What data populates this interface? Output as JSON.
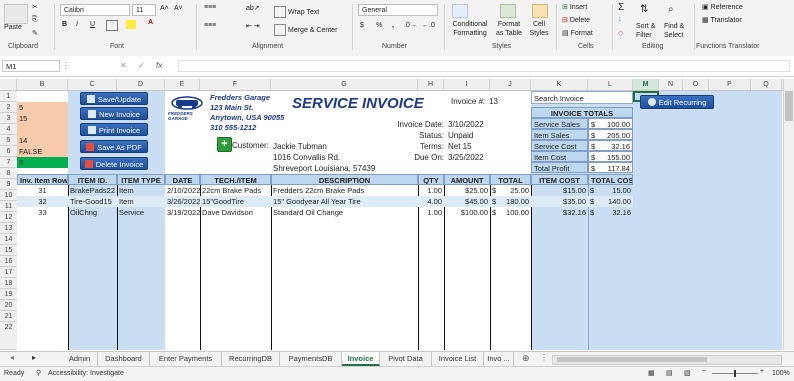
{
  "ribbon": {
    "clipboard": {
      "paste": "Paste",
      "label": "Clipboard"
    },
    "font": {
      "name": "Calibri",
      "size": "11",
      "label": "Font",
      "bold": "B",
      "italic": "I",
      "underline": "U"
    },
    "alignment": {
      "wrap": "Wrap Text",
      "merge": "Merge & Center",
      "label": "Alignment"
    },
    "number": {
      "format": "General",
      "label": "Number",
      "currency": "$",
      "percent": "%",
      "comma": ","
    },
    "styles": {
      "conditional": "Conditional Formatting",
      "table": "Format as Table",
      "cell": "Cell Styles",
      "label": "Styles"
    },
    "cells": {
      "insert": "Insert",
      "delete": "Delete",
      "format": "Format",
      "label": "Cells"
    },
    "editing": {
      "sum": "Σ",
      "sort": "Sort & Filter",
      "find": "Find & Select",
      "label": "Editing"
    },
    "translator": {
      "reference": "Reference",
      "translator": "Translator",
      "label": "Functions Translator"
    }
  },
  "formula_bar": {
    "name_box": "M1",
    "fx": "fx",
    "content": ""
  },
  "columns": [
    "A",
    "B",
    "C",
    "D",
    "E",
    "F",
    "G",
    "H",
    "I",
    "J",
    "K",
    "L",
    "M",
    "N",
    "O",
    "P",
    "Q"
  ],
  "rows": [
    "1",
    "2",
    "3",
    "4",
    "5",
    "6",
    "7",
    "8",
    "9",
    "10",
    "11",
    "12",
    "13",
    "14",
    "15",
    "16",
    "17",
    "18",
    "19",
    "20",
    "21",
    "22"
  ],
  "colB": {
    "r2": "5",
    "r3": "15",
    "r5": "14",
    "r6": "FALSE",
    "r7": "3",
    "r8": "Inv. Item Row"
  },
  "buttons": {
    "save_update": "Save/Update",
    "new_invoice": "New Invoice",
    "print_invoice": "Print Invoice",
    "save_pdf": "Save As PDF",
    "delete_invoice": "Delete Invoice",
    "edit_recurring": "Edit Recurring"
  },
  "company": {
    "name": "Fredders Garage",
    "address": "123 Main St.",
    "city": "Anytown, USA 90055",
    "phone": "310 555-1212",
    "logo_text": "FREDDERS GARAGE"
  },
  "invoice": {
    "title": "SERVICE INVOICE",
    "number_label": "Invoice #:",
    "number": "13",
    "date_label": "Invoice Date:",
    "date": "3/10/2022",
    "status_label": "Status:",
    "status": "Unpaid",
    "terms_label": "Terms:",
    "terms": "Net 15",
    "due_label": "Due On:",
    "due": "3/25/2022",
    "customer_label": "Customer:",
    "customer_name": "Jackie Tubman",
    "customer_addr1": "1016 Convallis Rd.",
    "customer_addr2": "Shreveport Louisiana, 57439"
  },
  "table": {
    "headers": {
      "item_id": "ITEM ID.",
      "item_type": "ITEM TYPE",
      "date": "DATE",
      "tech": "TECH./ITEM",
      "desc": "DESCRIPTION",
      "qty": "QTY",
      "amount": "AMOUNT",
      "total": "TOTAL",
      "item_cost": "ITEM COST",
      "total_cost": "TOTAL COST"
    },
    "rows": [
      {
        "row": "31",
        "id": "BrakePads22",
        "type": "Item",
        "date": "2/10/2022",
        "tech": "22cm Brake Pads",
        "desc": "Fredders 22cm Brake Pads",
        "qty": "1.00",
        "amount": "$25.00",
        "total_cur": "$",
        "total": "25.00",
        "cost": "$15.00",
        "tcost_cur": "$",
        "tcost": "15.00"
      },
      {
        "row": "32",
        "id": "Tire-Good15",
        "type": "Item",
        "date": "3/26/2022",
        "tech": "15\"GoodTire",
        "desc": "15\" Goodyear All Year Tire",
        "qty": "4.00",
        "amount": "$45.00",
        "total_cur": "$",
        "total": "180.00",
        "cost": "$35.00",
        "tcost_cur": "$",
        "tcost": "140.00"
      },
      {
        "row": "33",
        "id": "OilChng",
        "type": "Service",
        "date": "3/19/2022",
        "tech": "Dave Davidson",
        "desc": "Standard Oil Change",
        "qty": "1.00",
        "amount": "$100.00",
        "total_cur": "$",
        "total": "100.00",
        "cost": "$32.16",
        "tcost_cur": "$",
        "tcost": "32.16"
      }
    ]
  },
  "side_panel": {
    "search_label": "Search Invoice",
    "totals_title": "INVOICE TOTALS",
    "rows": [
      {
        "label": "Service Sales",
        "cur": "$",
        "value": "100.00"
      },
      {
        "label": "Item Sales",
        "cur": "$",
        "value": "205.00"
      },
      {
        "label": "Service Cost",
        "cur": "$",
        "value": "32.16"
      },
      {
        "label": "Item Cost",
        "cur": "$",
        "value": "155.00"
      },
      {
        "label": "Total Profit",
        "cur": "$",
        "value": "117.84"
      }
    ]
  },
  "sheet_tabs": [
    "Admin",
    "Dashboard",
    "Enter Payments",
    "RecurringDB",
    "PaymentsDB",
    "Invoice",
    "Pivot Data",
    "Invoice List",
    "Invo ..."
  ],
  "active_tab": "Invoice",
  "status_bar": {
    "ready": "Ready",
    "accessibility": "Accessibility: Investigate",
    "zoom": "100%"
  },
  "colors": {
    "accent": "#217346",
    "blue_panel": "#c9def3",
    "header_blue": "#bdd7ee",
    "orange": "#f8cbad",
    "green": "#00b050",
    "button_blue": "#2a5ca8"
  }
}
